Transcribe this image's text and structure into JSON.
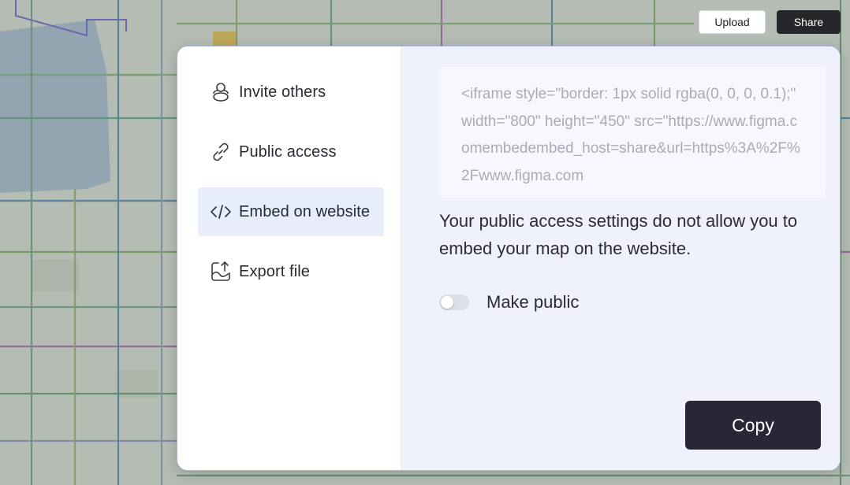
{
  "toolbar": {
    "upload_label": "Upload",
    "share_label": "Share"
  },
  "sidebar": {
    "items": [
      {
        "label": "Invite others",
        "icon": "people-icon",
        "active": false
      },
      {
        "label": "Public access",
        "icon": "link-icon",
        "active": false
      },
      {
        "label": "Embed on website",
        "icon": "code-icon",
        "active": true
      },
      {
        "label": "Export file",
        "icon": "export-icon",
        "active": false
      }
    ]
  },
  "embed": {
    "code": "<iframe style=\"border: 1px solid rgba(0, 0, 0, 0.1);\" width=\"800\" height=\"450\" src=\"https://www.figma.comembedembed_host=share&url=https%3A%2F%2Fwww.figma.com",
    "notice": "Your public access settings do not allow you to embed your map on the website.",
    "toggle_label": "Make public",
    "toggle_on": false,
    "copy_label": "Copy"
  },
  "colors": {
    "accent_dark": "#2a2638",
    "active_bg": "#e8edfb",
    "panel_bg": "#eff2fc"
  }
}
